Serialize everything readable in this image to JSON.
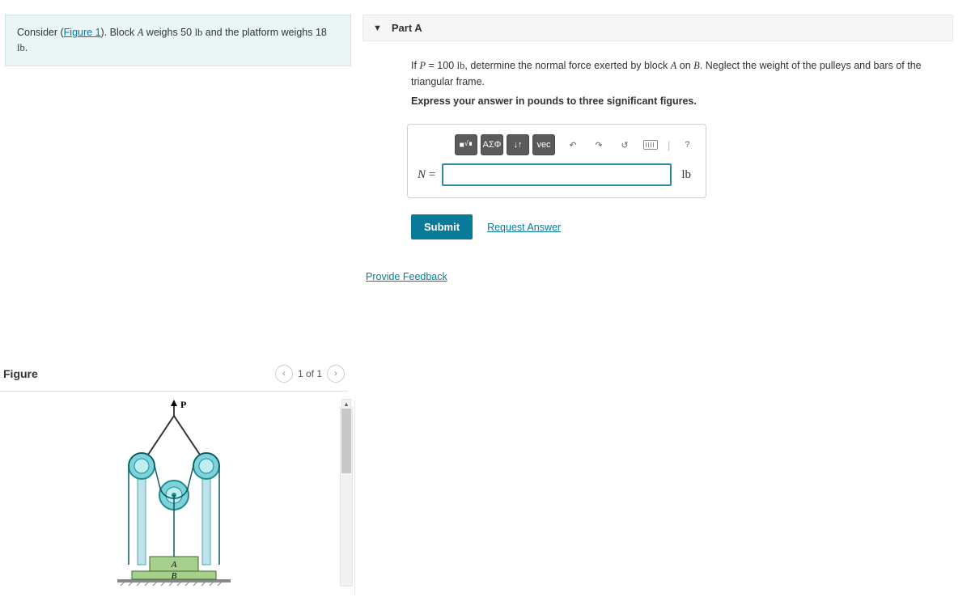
{
  "prompt": {
    "prefix": "Consider (",
    "figure_link": "Figure 1",
    "suffix_before_A": "). Block ",
    "A": "A",
    "mid1": " weighs 50 ",
    "lb1": "lb",
    "mid2": " and the platform weighs 18 ",
    "lb2": "lb",
    "end": "."
  },
  "figure": {
    "title": "Figure",
    "pager": "1 of 1",
    "label_P": "P",
    "label_A": "A",
    "label_B": "B"
  },
  "part": {
    "title": "Part A",
    "q_prefix": "If ",
    "P": "P",
    "q_mid1": " = 100 ",
    "q_lb": "lb",
    "q_mid2": ", determine the normal force exerted by block ",
    "q_A": "A",
    "q_on": " on ",
    "q_B": "B",
    "q_suffix": ". Neglect the weight of the pulleys and bars of the triangular frame.",
    "instruction": "Express your answer in pounds to three significant figures."
  },
  "toolbar": {
    "templates": "∎√∎",
    "greek": "ΑΣΦ",
    "subsup": "↓↑",
    "vec": "vec",
    "help": "?"
  },
  "answer": {
    "lhs_var": "N",
    "lhs_eq": " = ",
    "value": "",
    "unit": "lb"
  },
  "actions": {
    "submit": "Submit",
    "request": "Request Answer",
    "feedback": "Provide Feedback"
  }
}
